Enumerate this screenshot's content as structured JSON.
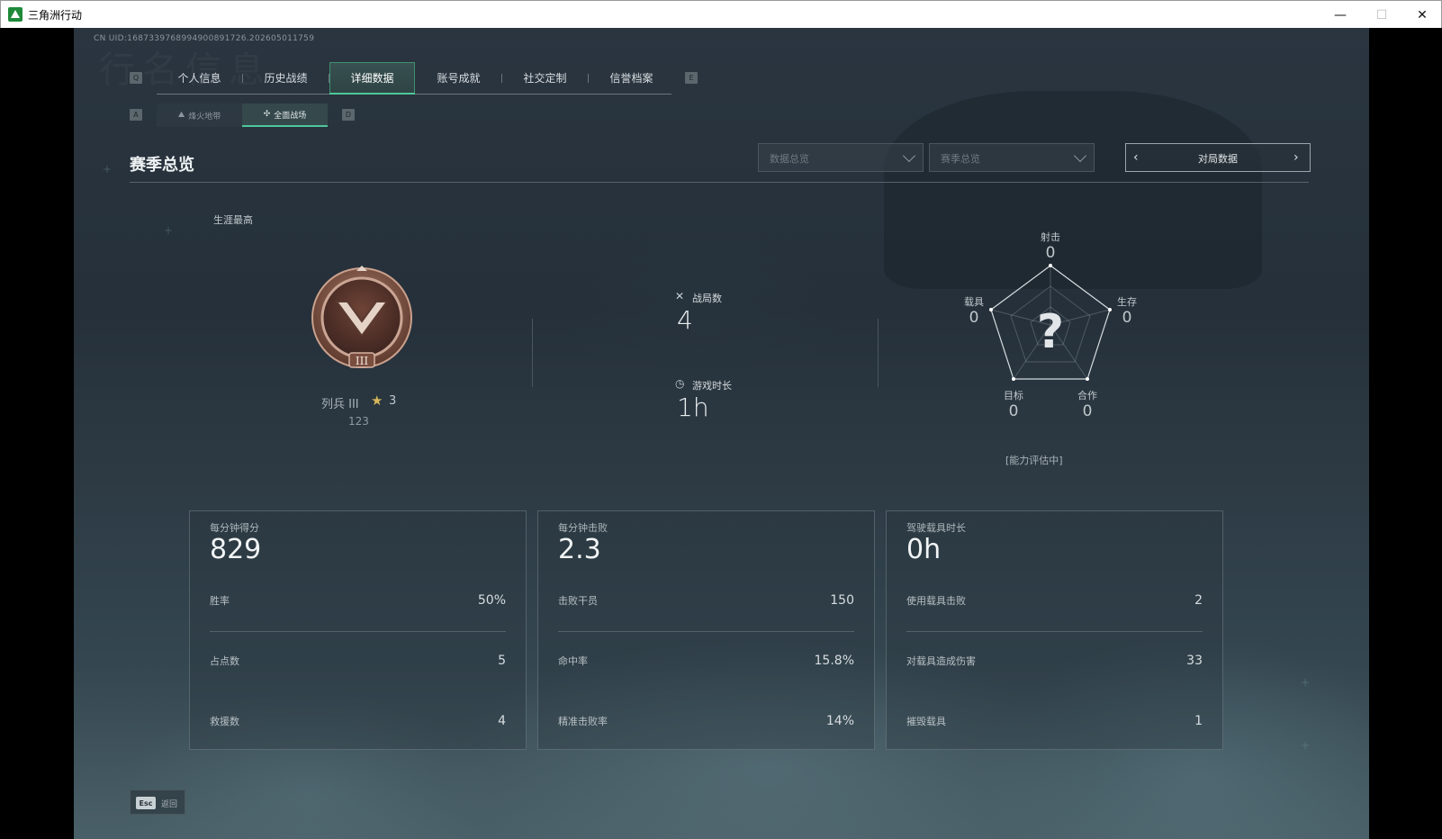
{
  "window": {
    "title": "三角洲行动",
    "min_glyph": "—",
    "max_glyph": "☐",
    "close_glyph": "✕"
  },
  "uid": "CN UID:1687339768994900891726.202605011759",
  "watermark": "行名信息",
  "key_hints": {
    "tab_prev": "Q",
    "tab_next": "E",
    "sub_prev": "A",
    "sub_next": "D"
  },
  "tabs": [
    {
      "label": "个人信息",
      "active": false
    },
    {
      "label": "历史战绩",
      "active": false
    },
    {
      "label": "详细数据",
      "active": true
    },
    {
      "label": "账号成就",
      "active": false
    },
    {
      "label": "社交定制",
      "active": false
    },
    {
      "label": "信誉档案",
      "active": false
    }
  ],
  "subtabs": [
    {
      "label": "烽火地带",
      "icon": "mountain-icon",
      "active": false
    },
    {
      "label": "全面战场",
      "icon": "crosshair-icon",
      "active": true
    }
  ],
  "section_title": "赛季总览",
  "filters": {
    "data_overview": "数据总览",
    "season_overview": "赛季总览",
    "pager_label": "对局数据"
  },
  "career": {
    "label": "生涯最高",
    "rank_name": "列兵 III",
    "rank_stars": "3",
    "rank_points": "123",
    "badge_numeral": "III"
  },
  "match_stats": {
    "matches_label": "战局数",
    "matches_value": "4",
    "playtime_label": "游戏时长",
    "playtime_value": "1h"
  },
  "radar": {
    "center_mark": "?",
    "shooting_label": "射击",
    "shooting_value": "0",
    "survival_label": "生存",
    "survival_value": "0",
    "teamwork_label": "合作",
    "teamwork_value": "0",
    "objective_label": "目标",
    "objective_value": "0",
    "vehicle_label": "载具",
    "vehicle_value": "0",
    "status": "[能力评估中]"
  },
  "cards": [
    {
      "head_label": "每分钟得分",
      "head_value": "829",
      "rows": [
        {
          "k": "胜率",
          "v": "50%"
        },
        {
          "k": "占点数",
          "v": "5"
        },
        {
          "k": "救援数",
          "v": "4"
        }
      ]
    },
    {
      "head_label": "每分钟击败",
      "head_value": "2.3",
      "rows": [
        {
          "k": "击败干员",
          "v": "150"
        },
        {
          "k": "命中率",
          "v": "15.8%"
        },
        {
          "k": "精准击败率",
          "v": "14%"
        }
      ]
    },
    {
      "head_label": "驾驶载具时长",
      "head_value": "0h",
      "rows": [
        {
          "k": "使用载具击败",
          "v": "2"
        },
        {
          "k": "对载具造成伤害",
          "v": "33"
        },
        {
          "k": "摧毁载具",
          "v": "1"
        }
      ]
    }
  ],
  "footer": {
    "esc_key": "Esc",
    "esc_label": "返回"
  },
  "colors": {
    "accent": "#4fc79a",
    "gold": "#d6b75a",
    "badge_bronze": "#8a5a4a"
  }
}
